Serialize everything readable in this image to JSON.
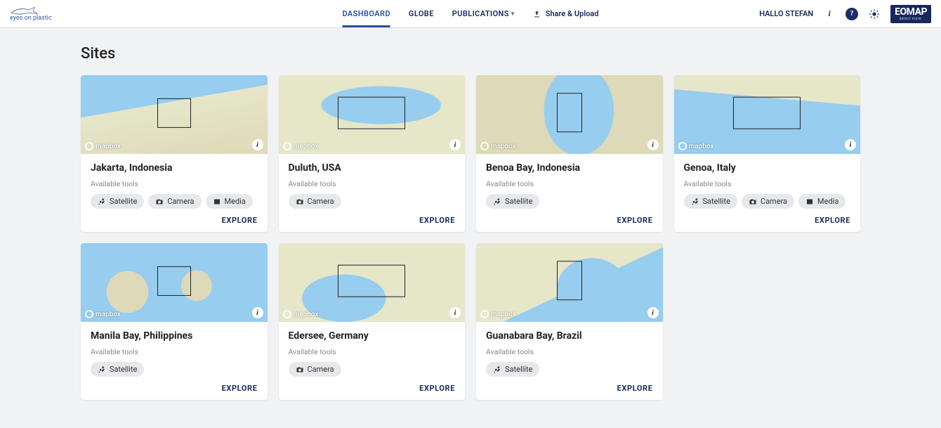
{
  "header": {
    "logo_text": "eyes on plastic",
    "nav": {
      "dashboard": "DASHBOARD",
      "globe": "GLOBE",
      "publications": "PUBLICATIONS",
      "share": "Share & Upload"
    },
    "user_greeting": "HALLO STEFAN",
    "eomap_brand": "EOMAP",
    "eomap_strap": "detect more."
  },
  "page_title": "Sites",
  "labels": {
    "available_tools": "Available tools",
    "explore": "EXPLORE",
    "mapbox": "mapbox"
  },
  "tool_labels": {
    "satellite": "Satellite",
    "camera": "Camera",
    "media": "Media"
  },
  "sites": [
    {
      "title": "Jakarta, Indonesia",
      "bg": "bg-sea-top-left",
      "roi": "",
      "tools": [
        "satellite",
        "camera",
        "media"
      ]
    },
    {
      "title": "Duluth, USA",
      "bg": "bg-lake",
      "roi": "wide",
      "tools": [
        "camera"
      ]
    },
    {
      "title": "Benoa Bay, Indonesia",
      "bg": "bg-bay",
      "roi": "tall",
      "tools": [
        "satellite"
      ]
    },
    {
      "title": "Genoa, Italy",
      "bg": "bg-gulf",
      "roi": "wide",
      "tools": [
        "satellite",
        "camera",
        "media"
      ]
    },
    {
      "title": "Manila Bay, Philippines",
      "bg": "bg-islands",
      "roi": "",
      "tools": [
        "satellite"
      ]
    },
    {
      "title": "Edersee, Germany",
      "bg": "bg-inland",
      "roi": "wide",
      "tools": [
        "camera"
      ]
    },
    {
      "title": "Guanabara Bay, Brazil",
      "bg": "bg-brazil",
      "roi": "tall",
      "tools": [
        "satellite"
      ]
    }
  ]
}
